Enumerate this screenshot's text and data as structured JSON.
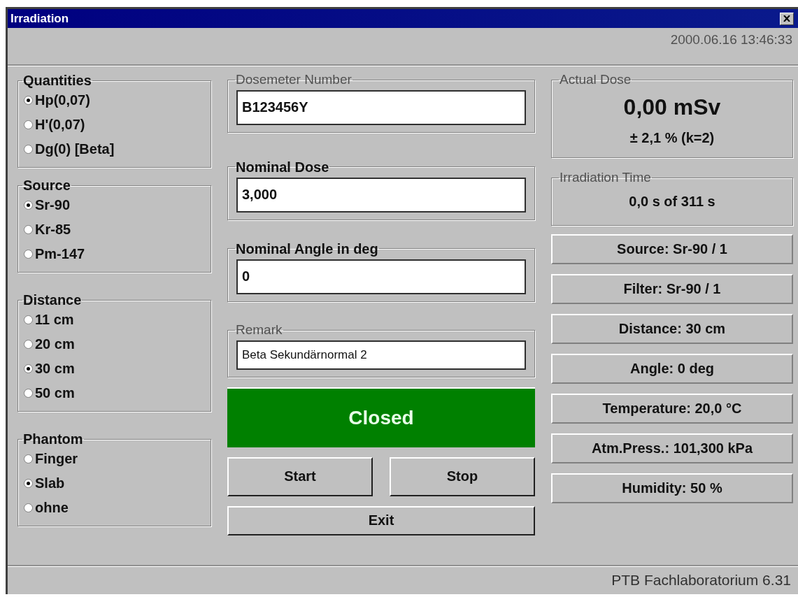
{
  "window": {
    "title": "Irradiation"
  },
  "timestamp": "2000.06.16 13:46:33",
  "option_groups": [
    {
      "title": "Quantities",
      "options": [
        {
          "label": "Hp(0,07)",
          "selected": true
        },
        {
          "label": "H'(0,07)",
          "selected": false
        },
        {
          "label": "Dg(0) [Beta]",
          "selected": false
        }
      ]
    },
    {
      "title": "Source",
      "options": [
        {
          "label": "Sr-90",
          "selected": true
        },
        {
          "label": "Kr-85",
          "selected": false
        },
        {
          "label": "Pm-147",
          "selected": false
        }
      ]
    },
    {
      "title": "Distance",
      "options": [
        {
          "label": "11 cm",
          "selected": false
        },
        {
          "label": "20 cm",
          "selected": false
        },
        {
          "label": "30 cm",
          "selected": true
        },
        {
          "label": "50 cm",
          "selected": false
        }
      ]
    },
    {
      "title": "Phantom",
      "options": [
        {
          "label": "Finger",
          "selected": false
        },
        {
          "label": "Slab",
          "selected": true
        },
        {
          "label": "ohne",
          "selected": false
        }
      ]
    }
  ],
  "fields": [
    {
      "label": "Dosemeter Number",
      "emphasized": false,
      "value": "B123456Y",
      "small": false
    },
    {
      "label": "Nominal Dose",
      "emphasized": true,
      "value": "3,000",
      "small": false
    },
    {
      "label": "Nominal Angle in deg",
      "emphasized": true,
      "value": "0",
      "small": false
    },
    {
      "label": "Remark",
      "emphasized": false,
      "value": "Beta Sekundärnormal 2",
      "small": true
    }
  ],
  "shutter_status": {
    "label": "Closed"
  },
  "buttons": [
    {
      "label": "Start"
    },
    {
      "label": "Stop"
    },
    {
      "label": "Exit"
    }
  ],
  "actual_dose": {
    "title": "Actual Dose",
    "value": "0,00 mSv",
    "uncertainty": "± 2,1 % (k=2)"
  },
  "irradiation_time": {
    "title": "Irradiation Time",
    "value": "0,0 s of 311 s"
  },
  "readouts": [
    "Source: Sr-90 / 1",
    "Filter: Sr-90 / 1",
    "Distance: 30 cm",
    "Angle: 0 deg",
    "Temperature: 20,0 °C",
    "Atm.Press.: 101,300 kPa",
    "Humidity: 50 %"
  ],
  "status_bar": "PTB Fachlaboratorium 6.31"
}
